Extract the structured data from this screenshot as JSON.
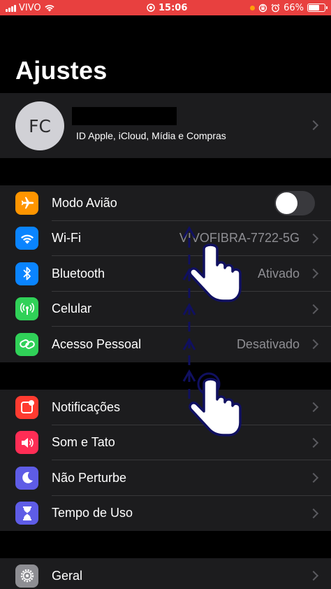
{
  "status_bar": {
    "carrier": "VIVO",
    "time": "15:06",
    "battery": "66%",
    "battery_level": 0.66
  },
  "title": "Ajustes",
  "profile": {
    "initials": "FC",
    "subtitle": "ID Apple, iCloud, Mídia e Compras"
  },
  "groups": [
    [
      {
        "label": "Modo Avião",
        "value": "",
        "icon": "airplane-icon",
        "color": "#ff9500",
        "toggle": false
      },
      {
        "label": "Wi-Fi",
        "value": "VIVOFIBRA-7722-5G",
        "icon": "wifi-icon",
        "color": "#0a84ff"
      },
      {
        "label": "Bluetooth",
        "value": "Ativado",
        "icon": "bluetooth-icon",
        "color": "#0a84ff"
      },
      {
        "label": "Celular",
        "value": "",
        "icon": "antenna-icon",
        "color": "#30d158"
      },
      {
        "label": "Acesso Pessoal",
        "value": "Desativado",
        "icon": "hotspot-icon",
        "color": "#30d158"
      }
    ],
    [
      {
        "label": "Notificações",
        "value": "",
        "icon": "notifications-icon",
        "color": "#ff3b30"
      },
      {
        "label": "Som e Tato",
        "value": "",
        "icon": "speaker-icon",
        "color": "#ff2d55"
      },
      {
        "label": "Não Perturbe",
        "value": "",
        "icon": "moon-icon",
        "color": "#5e5ce6"
      },
      {
        "label": "Tempo de Uso",
        "value": "",
        "icon": "hourglass-icon",
        "color": "#5e5ce6"
      }
    ],
    [
      {
        "label": "Geral",
        "value": "",
        "icon": "gear-icon",
        "color": "#8e8e93"
      }
    ]
  ]
}
